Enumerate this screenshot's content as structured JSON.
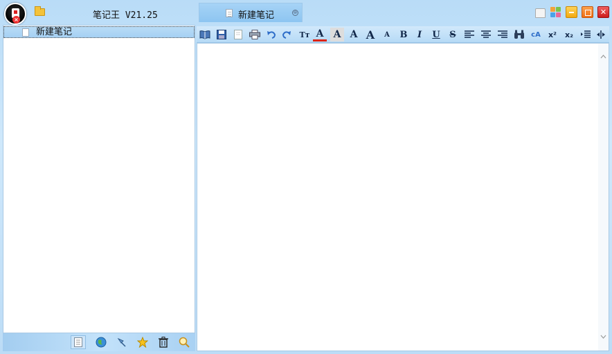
{
  "app": {
    "title": "笔记王 V21.25"
  },
  "tab": {
    "label": "新建笔记",
    "close_glyph": "⊗"
  },
  "window_controls": {
    "close_glyph": "✕"
  },
  "tree": {
    "items": [
      {
        "label": "新建笔记"
      }
    ]
  },
  "left_toolbar": {
    "buttons": [
      "note-list-icon",
      "globe-icon",
      "pushpin-icon",
      "star-icon",
      "trash-icon",
      "search-icon"
    ]
  },
  "editor_toolbar": {
    "font_size_label": "Tт",
    "font_color_label": "A",
    "highlight_label": "A",
    "font_label": "A",
    "grow_label": "A",
    "shrink_label": "A",
    "bold_label": "B",
    "italic_label": "I",
    "underline_label": "U",
    "strike_label": "S",
    "case_label": "cA",
    "superscript_label": "x²",
    "subscript_label": "x₂"
  },
  "colors": {
    "accent": "#8dc5f1",
    "background": "#c2e0f8",
    "editor": "#ffffff"
  }
}
